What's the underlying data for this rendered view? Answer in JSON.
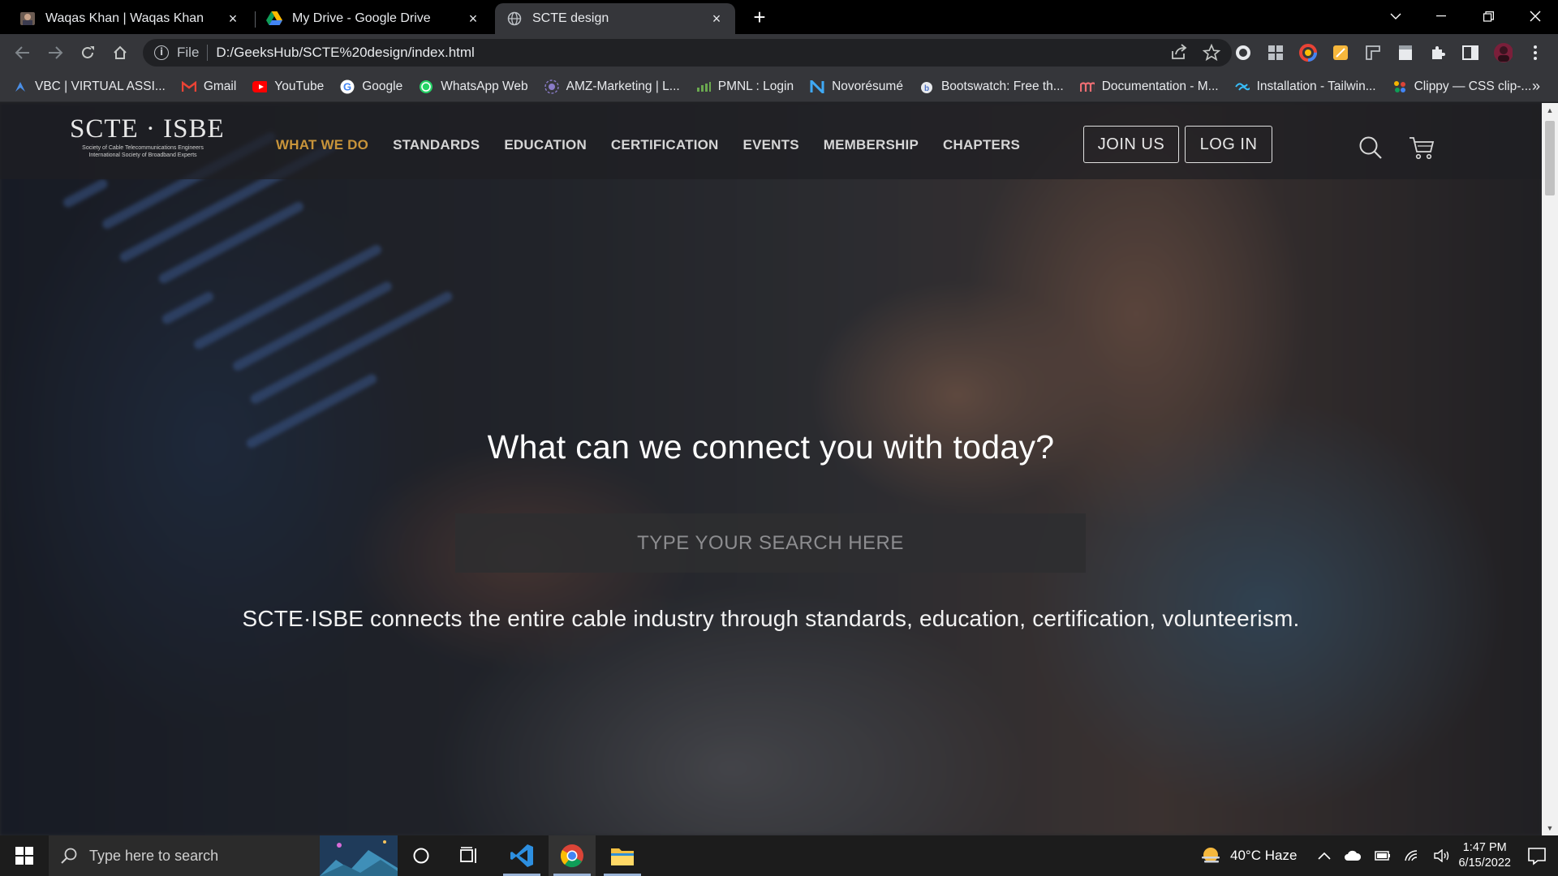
{
  "browser": {
    "tabs": [
      {
        "title": "Waqas Khan | Waqas Khan",
        "icon": "profile-photo-icon"
      },
      {
        "title": "My Drive - Google Drive",
        "icon": "google-drive-icon"
      },
      {
        "title": "SCTE design",
        "icon": "globe-icon",
        "active": true
      }
    ],
    "omnibox": {
      "scheme_label": "File",
      "url": "D:/GeeksHub/SCTE%20design/index.html"
    },
    "bookmarks": [
      {
        "label": "VBC | VIRTUAL ASSI...",
        "icon": "vbc-icon",
        "color": "#4a8fe7"
      },
      {
        "label": "Gmail",
        "icon": "gmail-icon",
        "color": "#ea4335"
      },
      {
        "label": "YouTube",
        "icon": "youtube-icon",
        "color": "#ff0000"
      },
      {
        "label": "Google",
        "icon": "google-icon",
        "color": "#4285f4"
      },
      {
        "label": "WhatsApp Web",
        "icon": "whatsapp-icon",
        "color": "#25d366"
      },
      {
        "label": "AMZ-Marketing | L...",
        "icon": "amz-icon",
        "color": "#8a7cc8"
      },
      {
        "label": "PMNL : Login",
        "icon": "pmnl-icon",
        "color": "#6aa84f"
      },
      {
        "label": "Novorésumé",
        "icon": "novoresume-icon",
        "color": "#3fa9f5"
      },
      {
        "label": "Bootswatch: Free th...",
        "icon": "bootswatch-icon",
        "color": "#e8eaed"
      },
      {
        "label": "Documentation - M...",
        "icon": "materialize-icon",
        "color": "#ee6e73"
      },
      {
        "label": "Installation - Tailwin...",
        "icon": "tailwind-icon",
        "color": "#38bdf8"
      },
      {
        "label": "Clippy — CSS clip-...",
        "icon": "clippy-icon",
        "color": "#f4b400"
      }
    ],
    "bookmarks_more": "»"
  },
  "site": {
    "logo": {
      "main": "SCTE · ISBE",
      "sub1": "Society of Cable Telecommunications Engineers",
      "sub2": "International Society of Broadband Experts"
    },
    "nav": [
      {
        "label": "WHAT WE DO",
        "active": true
      },
      {
        "label": "STANDARDS"
      },
      {
        "label": "EDUCATION"
      },
      {
        "label": "CERTIFICATION"
      },
      {
        "label": "EVENTS"
      },
      {
        "label": "MEMBERSHIP"
      },
      {
        "label": "CHAPTERS"
      }
    ],
    "join_label": "JOIN US",
    "login_label": "LOG IN",
    "accent_color": "#c8943a"
  },
  "hero": {
    "title": "What can we connect you with today?",
    "search_placeholder": "TYPE YOUR SEARCH HERE",
    "subtitle": "SCTE·ISBE connects the entire cable industry through standards, education, certification, volunteerism."
  },
  "taskbar": {
    "search_placeholder": "Type here to search",
    "weather": "40°C  Haze",
    "time": "1:47 PM",
    "date": "6/15/2022"
  }
}
